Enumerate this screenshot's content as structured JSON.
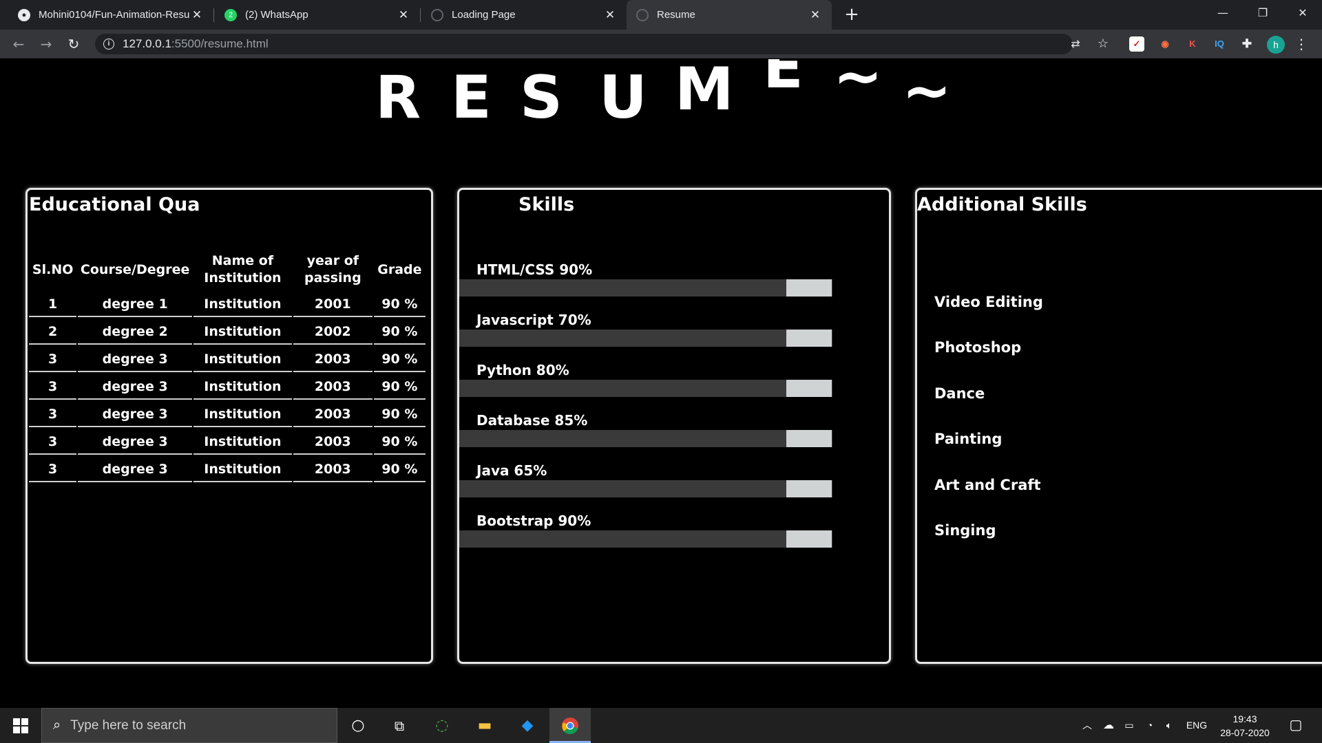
{
  "browser": {
    "tabs": [
      {
        "title": "Mohini0104/Fun-Animation-Resu",
        "icon": "github-icon"
      },
      {
        "title": "(2) WhatsApp",
        "icon": "whatsapp-icon",
        "badge": "2"
      },
      {
        "title": "Loading Page",
        "icon": "globe-icon"
      },
      {
        "title": "Resume",
        "icon": "globe-icon"
      }
    ],
    "url_host": "127.0.0.1",
    "url_path": ":5500/resume.html",
    "profile_initial": "h",
    "ext_k": "K",
    "ext_iq": "IQ",
    "accent_color": "#8ab4f8"
  },
  "page": {
    "title_letters": [
      "R",
      "E",
      "S",
      "U",
      "M",
      "E",
      "~",
      "~"
    ],
    "education": {
      "heading": "Educational Qua",
      "columns": [
        "Sl.NO",
        "Course/Degree",
        "Name of Institution",
        "year of passing",
        "Grade"
      ],
      "rows": [
        [
          "1",
          "degree 1",
          "Institution",
          "2001",
          "90 %"
        ],
        [
          "2",
          "degree 2",
          "Institution",
          "2002",
          "90 %"
        ],
        [
          "3",
          "degree 3",
          "Institution",
          "2003",
          "90 %"
        ],
        [
          "3",
          "degree 3",
          "Institution",
          "2003",
          "90 %"
        ],
        [
          "3",
          "degree 3",
          "Institution",
          "2003",
          "90 %"
        ],
        [
          "3",
          "degree 3",
          "Institution",
          "2003",
          "90 %"
        ],
        [
          "3",
          "degree 3",
          "Institution",
          "2003",
          "90 %"
        ]
      ]
    },
    "skills": {
      "heading": "Skills",
      "items": [
        {
          "label": "HTML/CSS 90%",
          "percent": 90
        },
        {
          "label": "Javascript 70%",
          "percent": 70
        },
        {
          "label": "Python 80%",
          "percent": 80
        },
        {
          "label": "Database 85%",
          "percent": 85
        },
        {
          "label": "Java 65%",
          "percent": 65
        },
        {
          "label": "Bootstrap 90%",
          "percent": 90
        }
      ]
    },
    "additional": {
      "heading": "Additional Skills",
      "items": [
        "Video Editing",
        "Photoshop",
        "Dance",
        "Painting",
        "Art and Craft",
        "Singing"
      ]
    }
  },
  "taskbar": {
    "search_placeholder": "Type here to search",
    "language": "ENG",
    "time": "19:43",
    "date": "28-07-2020"
  }
}
